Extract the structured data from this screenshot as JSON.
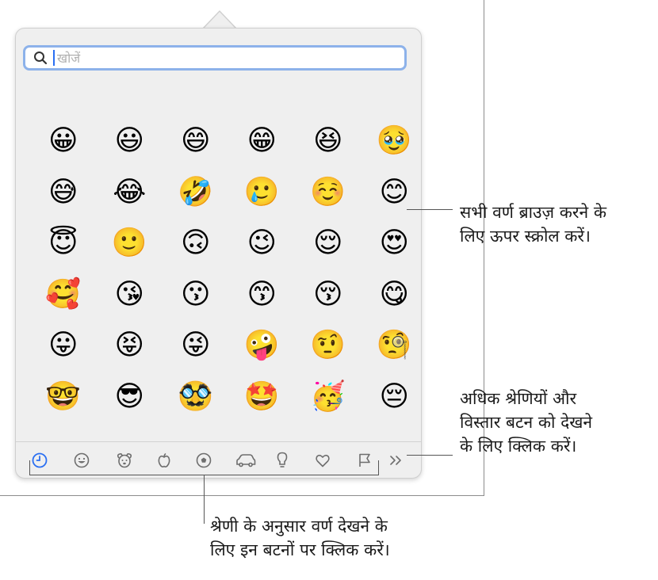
{
  "search": {
    "placeholder": "खोजें",
    "value": ""
  },
  "emoji_rows": [
    [
      "😀",
      "😃",
      "😄",
      "😁",
      "😆",
      "🥹"
    ],
    [
      "😅",
      "😂",
      "🤣",
      "🥲",
      "☺️",
      "😊"
    ],
    [
      "😇",
      "🙂",
      "🙃",
      "😉",
      "😌",
      "😍"
    ],
    [
      "🥰",
      "😘",
      "😗",
      "😙",
      "😚",
      "😋"
    ],
    [
      "😛",
      "😝",
      "😜",
      "🤪",
      "🤨",
      "🧐"
    ],
    [
      "🤓",
      "😎",
      "🥸",
      "🤩",
      "🥳",
      "😔"
    ]
  ],
  "category_tabs": [
    {
      "name": "recent",
      "icon": "clock-icon",
      "active": true
    },
    {
      "name": "smileys",
      "icon": "smiley-icon"
    },
    {
      "name": "animals",
      "icon": "dog-icon"
    },
    {
      "name": "food",
      "icon": "apple-icon"
    },
    {
      "name": "activity",
      "icon": "soccer-ball-icon"
    },
    {
      "name": "travel",
      "icon": "car-icon"
    },
    {
      "name": "objects",
      "icon": "lightbulb-icon"
    },
    {
      "name": "symbols",
      "icon": "heart-icon"
    },
    {
      "name": "flags",
      "icon": "flag-icon"
    },
    {
      "name": "more",
      "icon": "chevron-double-right-icon"
    }
  ],
  "colors": {
    "accent": "#2a6ff2",
    "search_border": "#8db2ea",
    "panel": "#efefef",
    "icon": "#6e6e6e"
  },
  "annotations": {
    "scroll": {
      "line1": "सभी वर्ण ब्राउज़ करने के",
      "line2": "लिए ऊपर स्क्रोल करें।"
    },
    "more": {
      "line1": "अधिक श्रेणियों और",
      "line2": "विस्तार बटन को देखने",
      "line3": "के लिए क्लिक करें।"
    },
    "categories": {
      "line1": "श्रेणी के अनुसार वर्ण देखने के",
      "line2": "लिए इन बटनों पर क्लिक करें।"
    }
  }
}
